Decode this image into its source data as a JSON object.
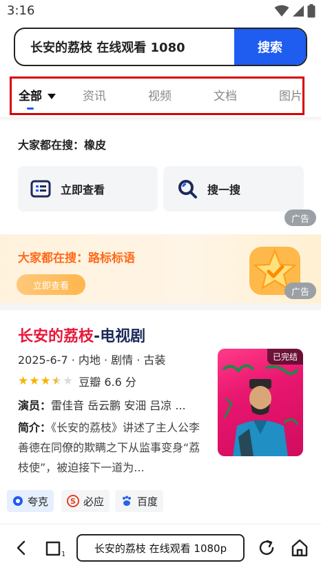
{
  "status_bar": {
    "time": "3:16"
  },
  "search": {
    "query": "长安的荔枝 在线观看 1080",
    "button": "搜索"
  },
  "tabs": [
    {
      "label": "全部",
      "active": true
    },
    {
      "label": "资讯"
    },
    {
      "label": "视频"
    },
    {
      "label": "文档"
    },
    {
      "label": "图片"
    }
  ],
  "trending": {
    "title": "大家都在搜：橡皮",
    "actions": [
      {
        "label": "立即查看"
      },
      {
        "label": "搜一搜"
      }
    ],
    "ad_label": "广告"
  },
  "banner": {
    "text": "大家都在搜：路标标语",
    "cta": "立即查看",
    "ad_label": "广告"
  },
  "result": {
    "title_highlight": "长安的荔枝",
    "title_rest": "-电视剧",
    "meta": "2025-6-7 · 内地 · 剧情 · 古装",
    "rating_stars": 3.5,
    "rating_text": "豆瓣 6.6 分",
    "cast_label": "演员：",
    "cast": "雷佳音 岳云鹏 安沺 吕凉 ...",
    "intro_label": "简介：",
    "intro": "《长安的荔枝》讲述了主人公李善德在同僚的欺瞒之下从监事变身“荔枝使”，被迫接下一道为...",
    "poster_badge": "已完结"
  },
  "sources": [
    {
      "label": "夸克"
    },
    {
      "label": "必应"
    },
    {
      "label": "百度"
    }
  ],
  "bottom_bar": {
    "url_text": "长安的荔枝 在线观看 1080p"
  },
  "colors": {
    "accent": "#1f5cf0",
    "highlight": "#e8173a",
    "tab_outline": "#d80000",
    "banner_text": "#ff6a1a"
  }
}
